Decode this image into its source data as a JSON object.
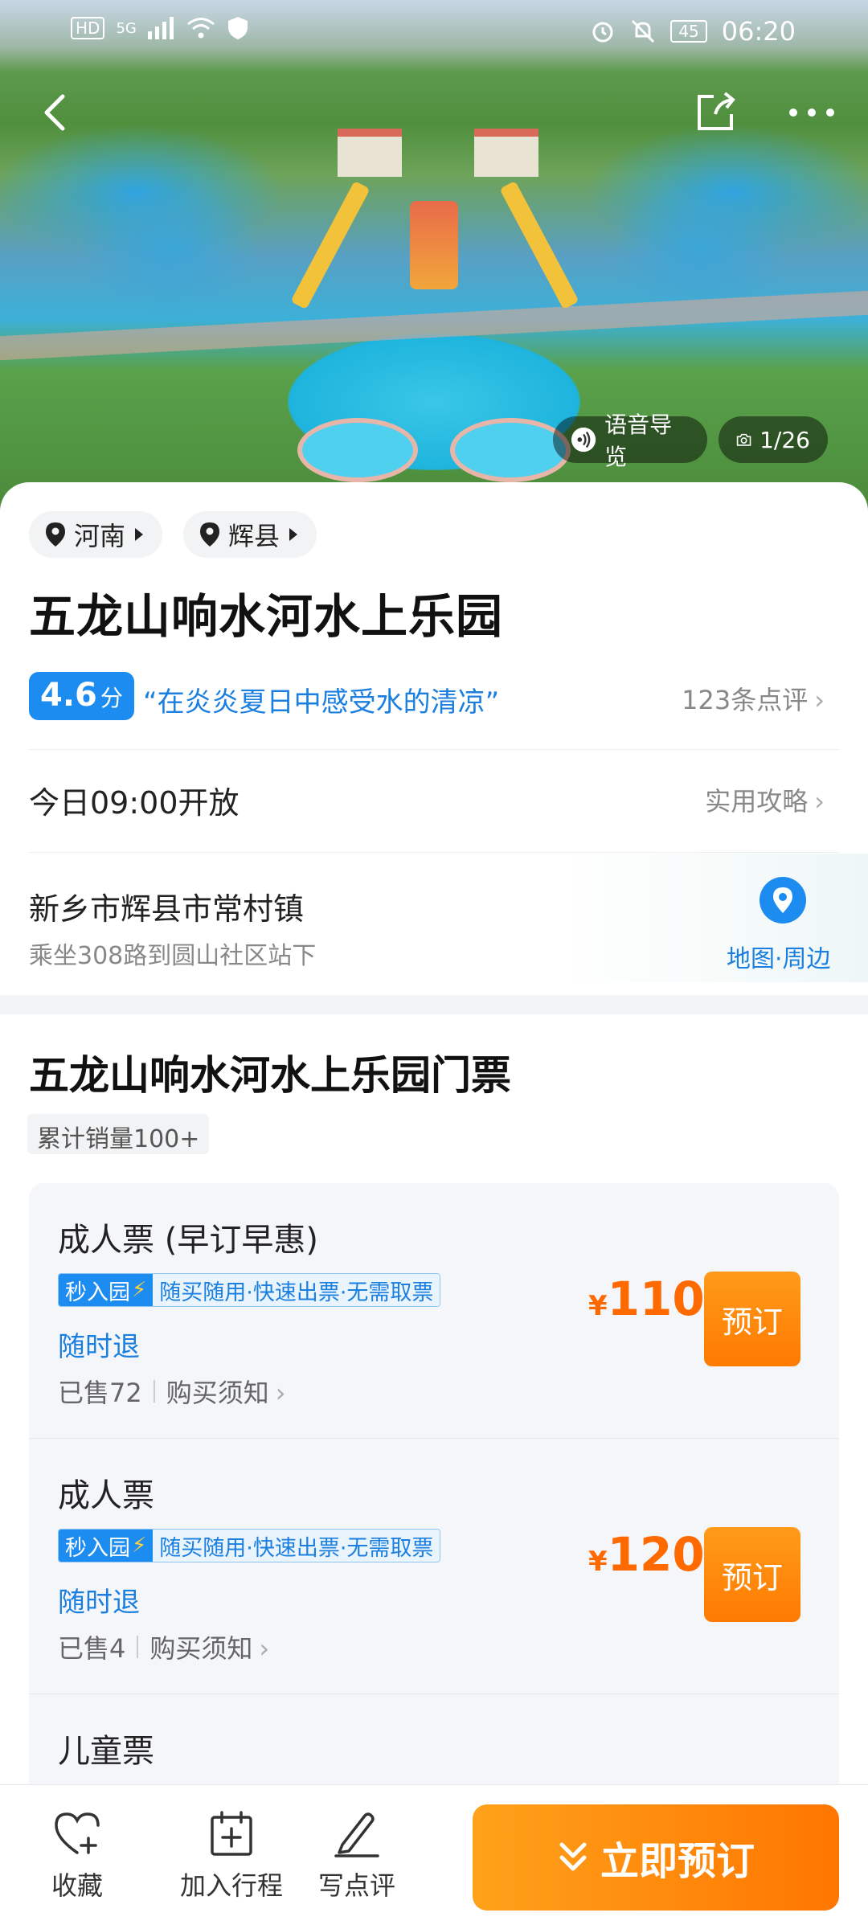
{
  "status_bar": {
    "network": "HD",
    "signal": "5G",
    "battery": "45",
    "time": "06:20"
  },
  "hero": {
    "voice_guide": "语音导览",
    "photo_counter": "1/26"
  },
  "location": {
    "province": "河南",
    "county": "辉县"
  },
  "attraction": {
    "title": "五龙山响水河水上乐园",
    "score": "4.6",
    "score_unit": "分",
    "quote": "“在炎炎夏日中感受水的清凉”",
    "review_count": "123条点评",
    "open_status": "今日09:00开放",
    "guide_link": "实用攻略",
    "address": "新乡市辉县市常村镇",
    "transit": "乘坐308路到圆山社区站下",
    "map_label": "地图·周边"
  },
  "tickets": {
    "section_title": "五龙山响水河水上乐园门票",
    "sales_badge": "累计销量100+",
    "items": [
      {
        "name": "成人票 (早订早惠)",
        "tag_fast": "秒入园",
        "tag_desc": "随买随用·快速出票·无需取票",
        "refund": "随时退",
        "sold": "已售72",
        "notice": "购买须知",
        "currency": "¥",
        "price": "110",
        "book_label": "预订"
      },
      {
        "name": "成人票",
        "tag_fast": "秒入园",
        "tag_desc": "随买随用·快速出票·无需取票",
        "refund": "随时退",
        "sold": "已售4",
        "notice": "购买须知",
        "currency": "¥",
        "price": "120",
        "book_label": "预订"
      },
      {
        "name": "儿童票"
      }
    ]
  },
  "bottom_bar": {
    "favorite": "收藏",
    "add_itinerary": "加入行程",
    "write_review": "写点评",
    "book_now": "立即预订"
  },
  "colors": {
    "accent_blue": "#1c8cf0",
    "price_orange": "#ff6a00",
    "cta_orange": "#ff8a00"
  },
  "icons": [
    "back-icon",
    "share-icon",
    "more-icon",
    "voice-icon",
    "camera-icon",
    "location-pin-icon",
    "map-pin-icon",
    "heart-plus-icon",
    "calendar-plus-icon",
    "pencil-icon",
    "chevron-down-icon",
    "lightning-icon"
  ]
}
